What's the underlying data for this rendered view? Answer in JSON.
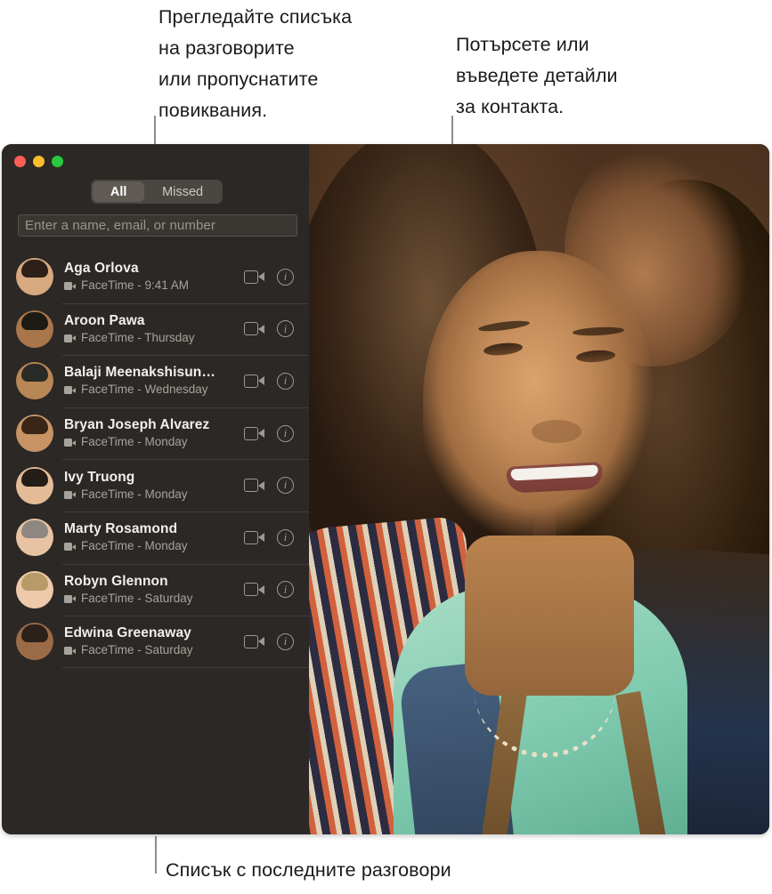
{
  "callouts": {
    "left": "Прегледайте списъка\nна разговорите\nили пропуснатите\nповиквания.",
    "right": "Потърсете или\nвъведете детайли\nза контакта.",
    "bottom": "Списък с последните разговори"
  },
  "window": {
    "traffic_lights": [
      {
        "name": "close",
        "color": "#FF5F57"
      },
      {
        "name": "minimize",
        "color": "#FEBC2E"
      },
      {
        "name": "zoom",
        "color": "#28C840"
      }
    ],
    "segmented_control": {
      "options": [
        "All",
        "Missed"
      ],
      "selected": "All"
    },
    "search": {
      "placeholder": "Enter a name, email, or number",
      "value": ""
    },
    "calls": [
      {
        "name": "Aga Orlova",
        "detail": "FaceTime - 9:41 AM",
        "hair": "#2c2018",
        "skin": "#d8a87e"
      },
      {
        "name": "Aroon Pawa",
        "detail": "FaceTime - Thursday",
        "hair": "#1d1a14",
        "skin": "#a9754a"
      },
      {
        "name": "Balaji Meenakshisun…",
        "detail": "FaceTime - Wednesday",
        "hair": "#2a2a26",
        "skin": "#b98656"
      },
      {
        "name": "Bryan Joseph Alvarez",
        "detail": "FaceTime - Monday",
        "hair": "#3a2517",
        "skin": "#c79264"
      },
      {
        "name": "Ivy Truong",
        "detail": "FaceTime - Monday",
        "hair": "#241c16",
        "skin": "#e3bb96"
      },
      {
        "name": "Marty Rosamond",
        "detail": "FaceTime - Monday",
        "hair": "#8e8781",
        "skin": "#e7c3a4"
      },
      {
        "name": "Robyn Glennon",
        "detail": "FaceTime - Saturday",
        "hair": "#b79a68",
        "skin": "#eec9aa"
      },
      {
        "name": "Edwina Greenaway",
        "detail": "FaceTime - Saturday",
        "hair": "#2b211a",
        "skin": "#9b6b47"
      }
    ],
    "row_actions": {
      "video_icon": "video-camera-icon",
      "info_icon": "info-circle-icon"
    }
  }
}
